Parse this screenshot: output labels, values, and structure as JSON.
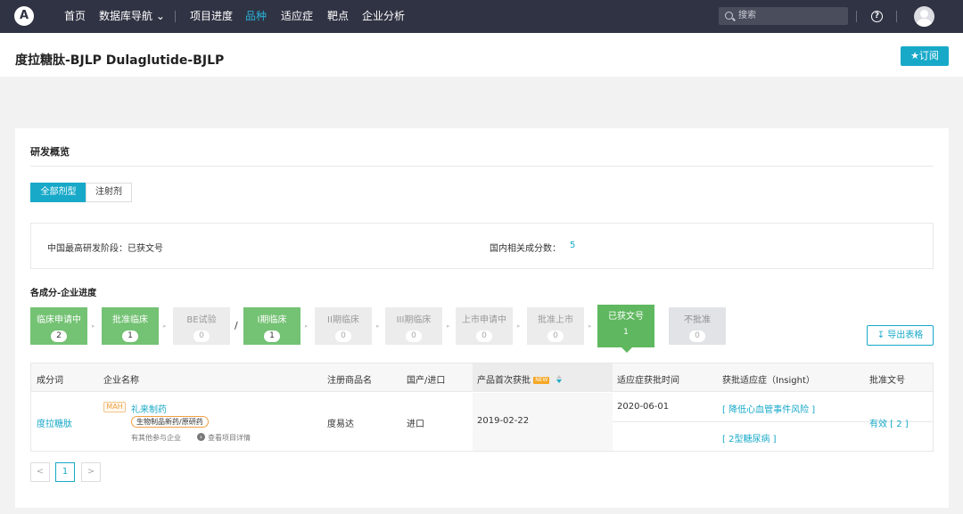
{
  "nav": {
    "logo": "A",
    "items": [
      "首页",
      "数据库导航 ⌄",
      "项目进度",
      "品种",
      "适应症",
      "靶点",
      "企业分析"
    ],
    "search_placeholder": "搜索",
    "help": "?"
  },
  "title": {
    "text": "度拉糖肽-BJLP Dulaglutide-BJLP",
    "subscribe": "★订阅"
  },
  "overview": {
    "title": "研发概览",
    "tabs": [
      "全部剂型",
      "注射剂"
    ],
    "highest_stage_label": "中国最高研发阶段：已获文号",
    "component_count_label": "国内相关成分数：",
    "component_count_value": "5"
  },
  "progress": {
    "title": "各成分-企业进度",
    "stages": [
      {
        "name": "临床申请中",
        "count": "2"
      },
      {
        "name": "批准临床",
        "count": "1"
      },
      {
        "name": "BE试验",
        "count": "0"
      },
      {
        "name": "I期临床",
        "count": "1"
      },
      {
        "name": "II期临床",
        "count": "0"
      },
      {
        "name": "III期临床",
        "count": "0"
      },
      {
        "name": "上市申请中",
        "count": "0"
      },
      {
        "name": "批准上市",
        "count": "0"
      },
      {
        "name": "已获文号",
        "count": "1"
      },
      {
        "name": "不批准",
        "count": "0"
      }
    ],
    "slash": "/",
    "export": "导出表格"
  },
  "table": {
    "headers": [
      "成分词",
      "企业名称",
      "注册商品名",
      "国产/进口",
      "产品首次获批",
      "适应症获批时间",
      "获批适应症（Insight）",
      "批准文号"
    ],
    "new_badge": "NEW",
    "row": {
      "ingredient": "度拉糖肽",
      "mah": "MAH",
      "company": "礼来制药",
      "tag": "生物制品新药/原研药",
      "participating": "有其他参与企业",
      "view_detail": "查看项目详情",
      "brand": "度易达",
      "origin": "进口",
      "first_approval": "2019-02-22",
      "indication_date": "2020-06-01",
      "indications": [
        "[ 降低心血管事件风险 ]",
        "[ 2型糖尿病 ]"
      ],
      "approval": "有效 [ 2 ]"
    }
  },
  "pagination": {
    "prev": "<",
    "current": "1",
    "next": ">"
  }
}
